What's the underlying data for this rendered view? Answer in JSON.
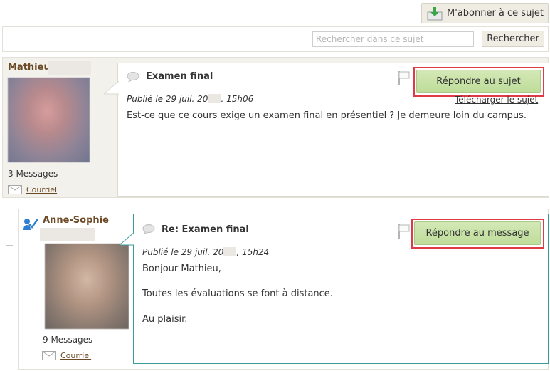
{
  "toolbar": {
    "subscribe_label": "M'abonner à ce sujet",
    "search_placeholder": "Rechercher dans ce sujet",
    "search_button": "Rechercher"
  },
  "posts": [
    {
      "author": "Mathieu",
      "subject": "Examen final",
      "published": "Publié le 29 juil. 20",
      "published_time": ". 15h06",
      "reply_label": "Répondre au sujet",
      "download_label": "Télécharger le sujet",
      "body": [
        "Est-ce que ce cours exige un examen final en présentiel ? Je demeure loin du campus."
      ],
      "message_count": "3 Messages",
      "email_label": "Courriel"
    },
    {
      "author": "Anne-Sophie",
      "subject": "Re: Examen final",
      "published": "Publié le 29 juil. 20",
      "published_time": ", 15h24",
      "reply_label": "Répondre au message",
      "body": [
        "Bonjour Mathieu,",
        "Toutes les évaluations se font à distance.",
        "Au plaisir."
      ],
      "message_count": "9 Messages",
      "email_label": "Courriel"
    }
  ],
  "colors": {
    "author": "#6b4a25",
    "reply_button": "#c6e2a4",
    "highlight": "#e03a44",
    "reply_border": "#3b9b98"
  }
}
